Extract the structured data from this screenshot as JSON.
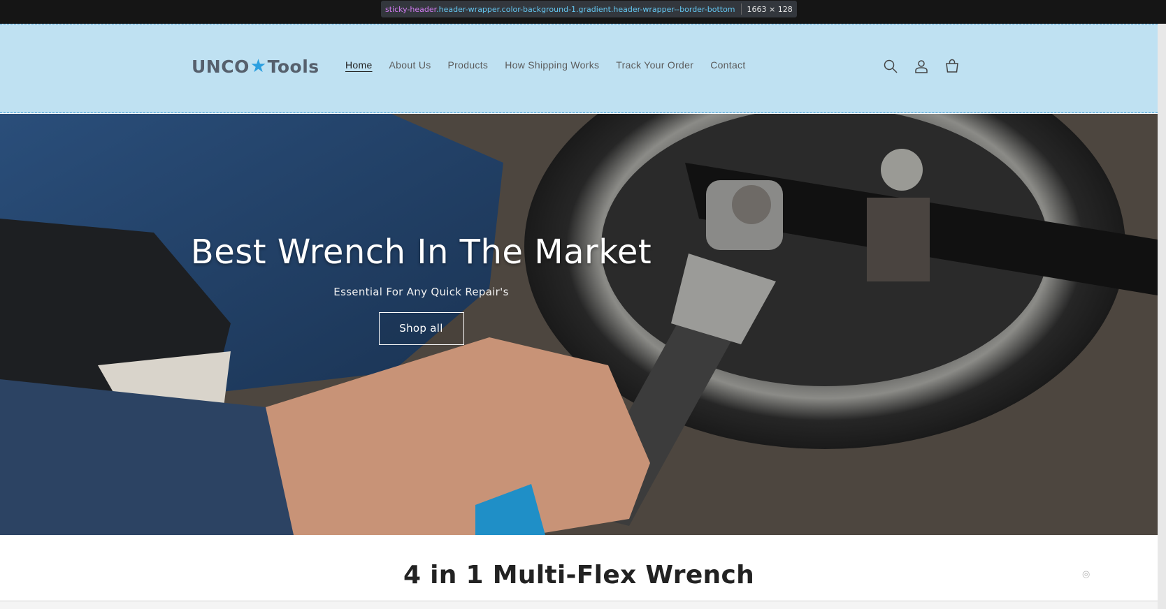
{
  "inspector": {
    "tag": "sticky-header",
    "classes": ".header-wrapper.color-background-1.gradient.header-wrapper--border-bottom",
    "dimensions": "1663 × 128"
  },
  "header": {
    "logo": {
      "left": "UNCO",
      "right": "Tools"
    },
    "nav": [
      {
        "label": "Home",
        "active": true
      },
      {
        "label": "About Us"
      },
      {
        "label": "Products"
      },
      {
        "label": "How Shipping Works"
      },
      {
        "label": "Track Your Order"
      },
      {
        "label": "Contact"
      }
    ],
    "icons": [
      "search-icon",
      "account-icon",
      "cart-icon"
    ]
  },
  "hero": {
    "title": "Best Wrench In The Market",
    "subtitle": "Essential For Any Quick Repair's",
    "button_label": "Shop all"
  },
  "section": {
    "title": "4 in 1 Multi-Flex Wrench"
  },
  "colors": {
    "header_bg": "#bfe1f2",
    "accent": "#2a9fe0",
    "hero_text": "#ffffff"
  }
}
